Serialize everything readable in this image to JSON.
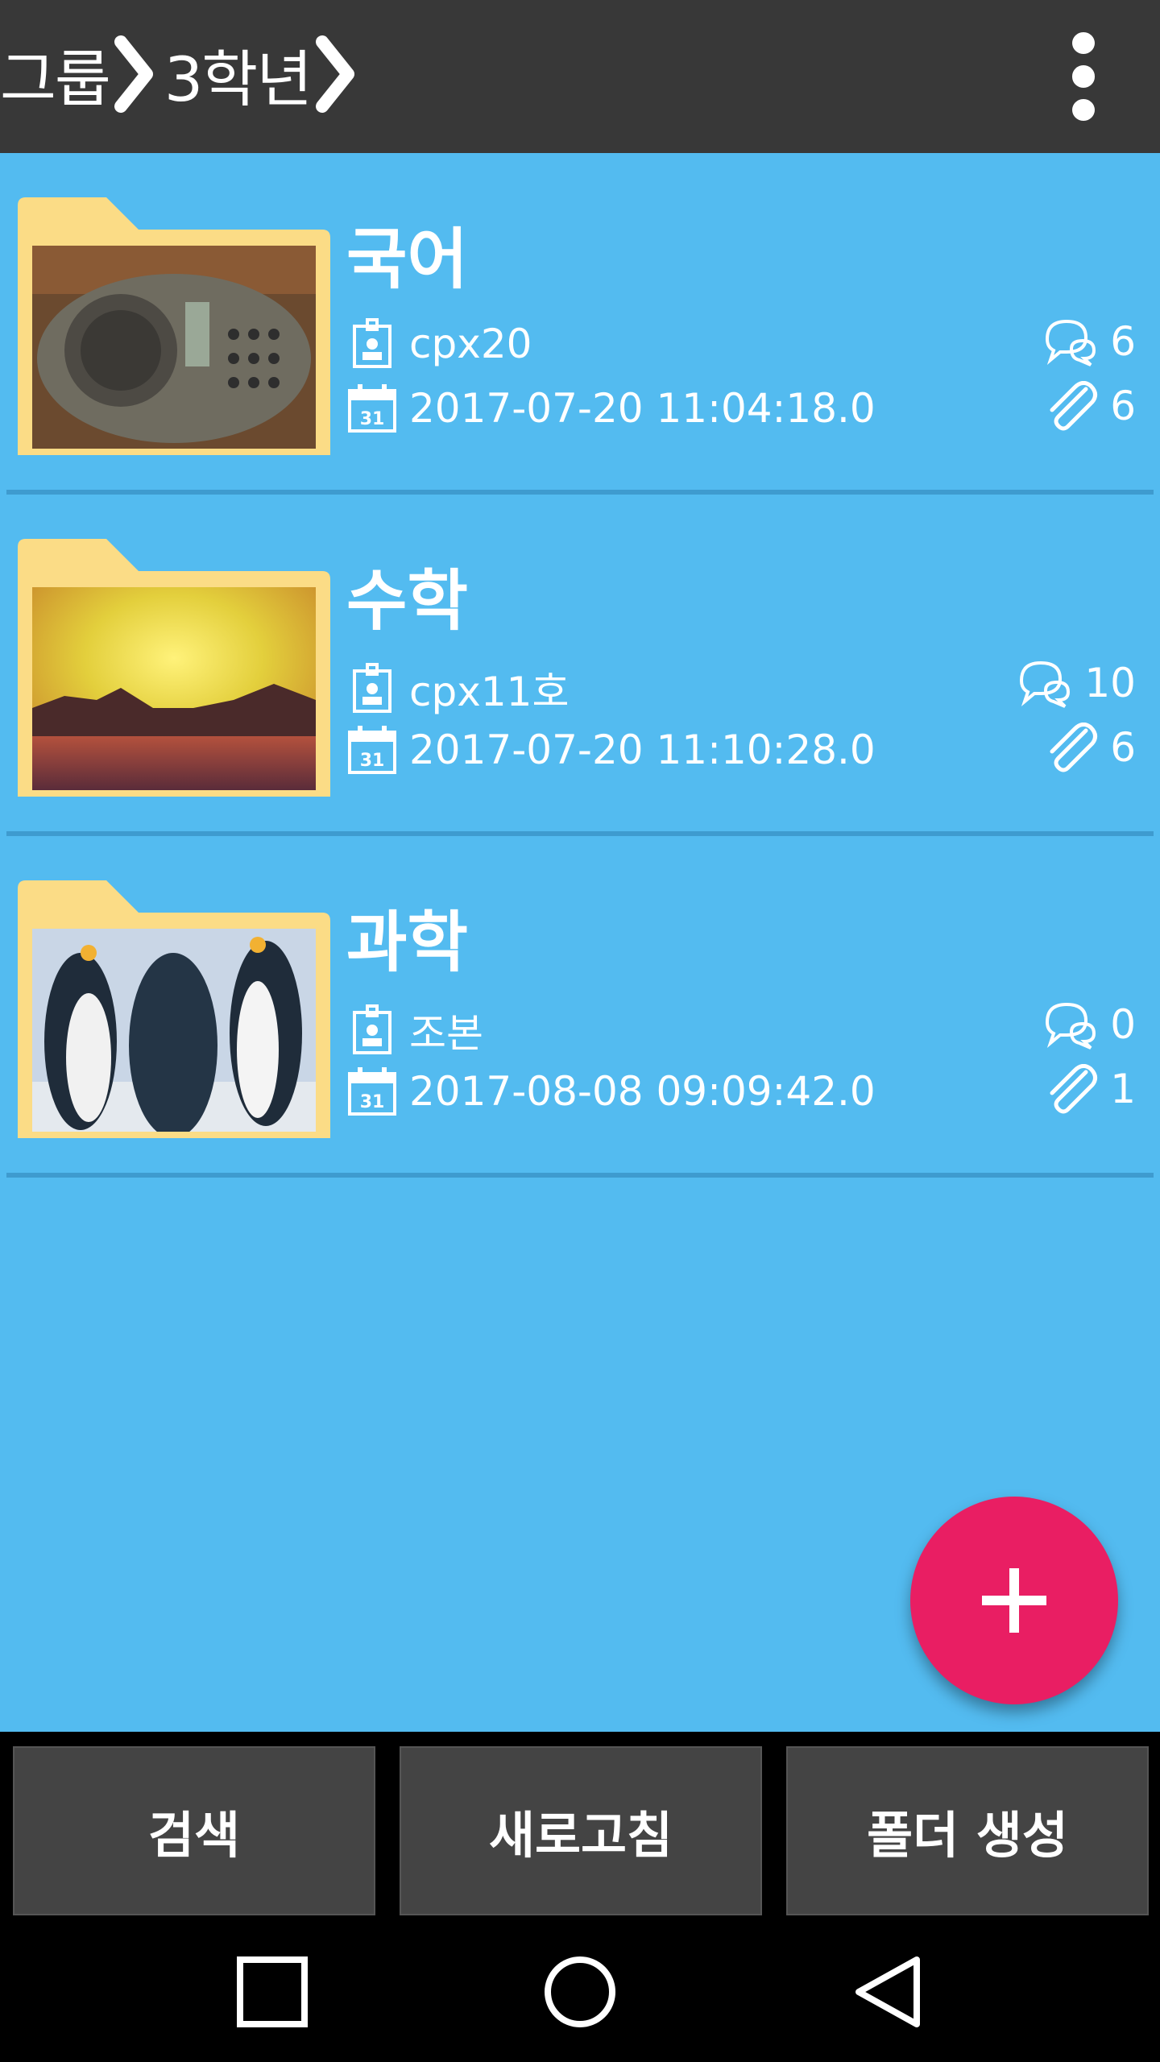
{
  "header": {
    "breadcrumb": [
      "그룹",
      "3학년"
    ],
    "menu_icon": "more-vert-icon"
  },
  "folders": [
    {
      "name": "국어",
      "author": "cpx20",
      "date": "2017-07-20 11:04:18.0",
      "comments": "6",
      "attachments": "6",
      "thumbnail": "conference-phone-photo"
    },
    {
      "name": "수학",
      "author": "cpx11호",
      "date": "2017-07-20 11:10:28.0",
      "comments": "10",
      "attachments": "6",
      "thumbnail": "sunset-photo"
    },
    {
      "name": "과학",
      "author": "조본",
      "date": "2017-08-08 09:09:42.0",
      "comments": "0",
      "attachments": "1",
      "thumbnail": "penguins-photo"
    }
  ],
  "fab": {
    "icon": "plus-icon"
  },
  "buttons": {
    "search": "검색",
    "refresh": "새로고침",
    "create_folder": "폴더 생성"
  },
  "navbar": {
    "recents": "square-icon",
    "home": "circle-icon",
    "back": "triangle-back-icon"
  },
  "colors": {
    "background": "#53bbf0",
    "topbar": "#383838",
    "fab": "#e91e63",
    "folder": "#fbdc86"
  }
}
